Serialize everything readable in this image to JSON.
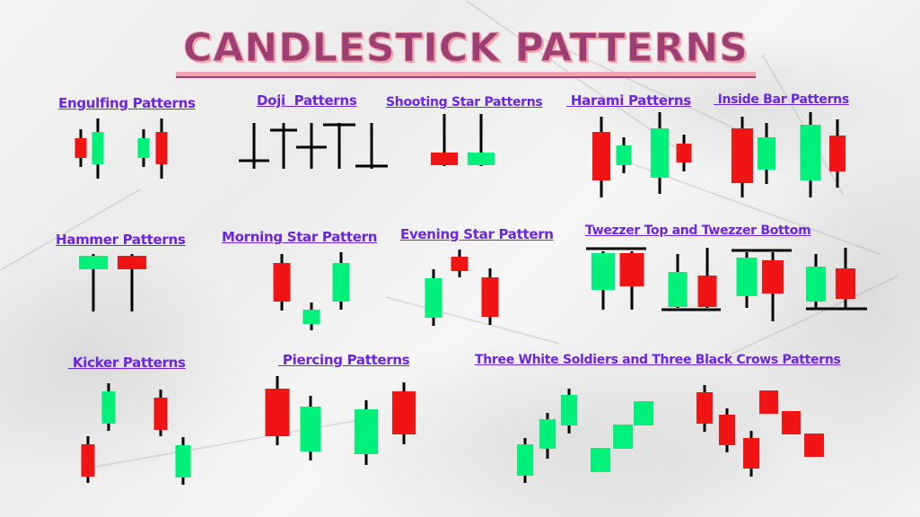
{
  "title": "CANDLESTICK PATTERNS",
  "colors": {
    "bullish": "#00f07a",
    "bearish": "#f01414",
    "wick": "#000000",
    "heading": "#6a25e6",
    "title_fill": "#9c3f74",
    "title_outline": "#f19aa6"
  },
  "patterns": [
    {
      "id": "engulfing",
      "heading": "Engulfing Patterns",
      "candles": [
        "bearish small",
        "bullish engulfing",
        "bullish small",
        "bearish engulfing"
      ]
    },
    {
      "id": "doji",
      "heading": "Doji  Patterns",
      "candles": [
        "gravestone doji",
        "long-legged doji (high body)",
        "long-legged doji (low body)",
        "dragonfly doji",
        "gravestone doji"
      ]
    },
    {
      "id": "shooting-star",
      "heading": "Shooting Star Patterns",
      "candles": [
        "bearish shooting star",
        "bullish shooting star"
      ]
    },
    {
      "id": "harami",
      "heading": " Harami Patterns",
      "candles": [
        "bearish large",
        "bullish small",
        "bullish large",
        "bearish small"
      ]
    },
    {
      "id": "inside-bar",
      "heading": " Inside Bar Patterns",
      "candles": [
        "bearish mother",
        "bullish inside",
        "bullish mother",
        "bearish inside"
      ]
    },
    {
      "id": "hammer",
      "heading": "Hammer Patterns",
      "candles": [
        "bullish hammer",
        "bearish hammer"
      ]
    },
    {
      "id": "morning-star",
      "heading": "Morning Star Pattern",
      "candles": [
        "bearish",
        "bullish star",
        "bullish"
      ]
    },
    {
      "id": "evening-star",
      "heading": "Evening Star Pattern",
      "candles": [
        "bullish",
        "bearish star",
        "bearish"
      ]
    },
    {
      "id": "tweezer",
      "heading": "Twezzer Top and Twezzer Bottom",
      "candles": [
        "tweezer top bullish",
        "tweezer top bearish",
        "tweezer bottom bullish",
        "tweezer bottom bearish",
        "tweezer top bullish",
        "tweezer top bearish",
        "tweezer bottom bullish",
        "tweezer bottom bearish"
      ]
    },
    {
      "id": "kicker",
      "heading": " Kicker Patterns",
      "candles": [
        "bearish",
        "bullish gap up",
        "bearish",
        "bullish gap down"
      ]
    },
    {
      "id": "piercing",
      "heading": " Piercing Patterns",
      "candles": [
        "bearish",
        "bullish",
        "bullish",
        "bearish"
      ]
    },
    {
      "id": "soldiers-crows",
      "heading": "Three White Soldiers and Three Black Crows Patterns",
      "candles": [
        "soldier 1",
        "soldier 2",
        "soldier 3",
        "soldier block 1",
        "soldier block 2",
        "soldier block 3",
        "crow 1",
        "crow 2",
        "crow 3",
        "crow block 1",
        "crow block 2",
        "crow block 3"
      ]
    }
  ]
}
